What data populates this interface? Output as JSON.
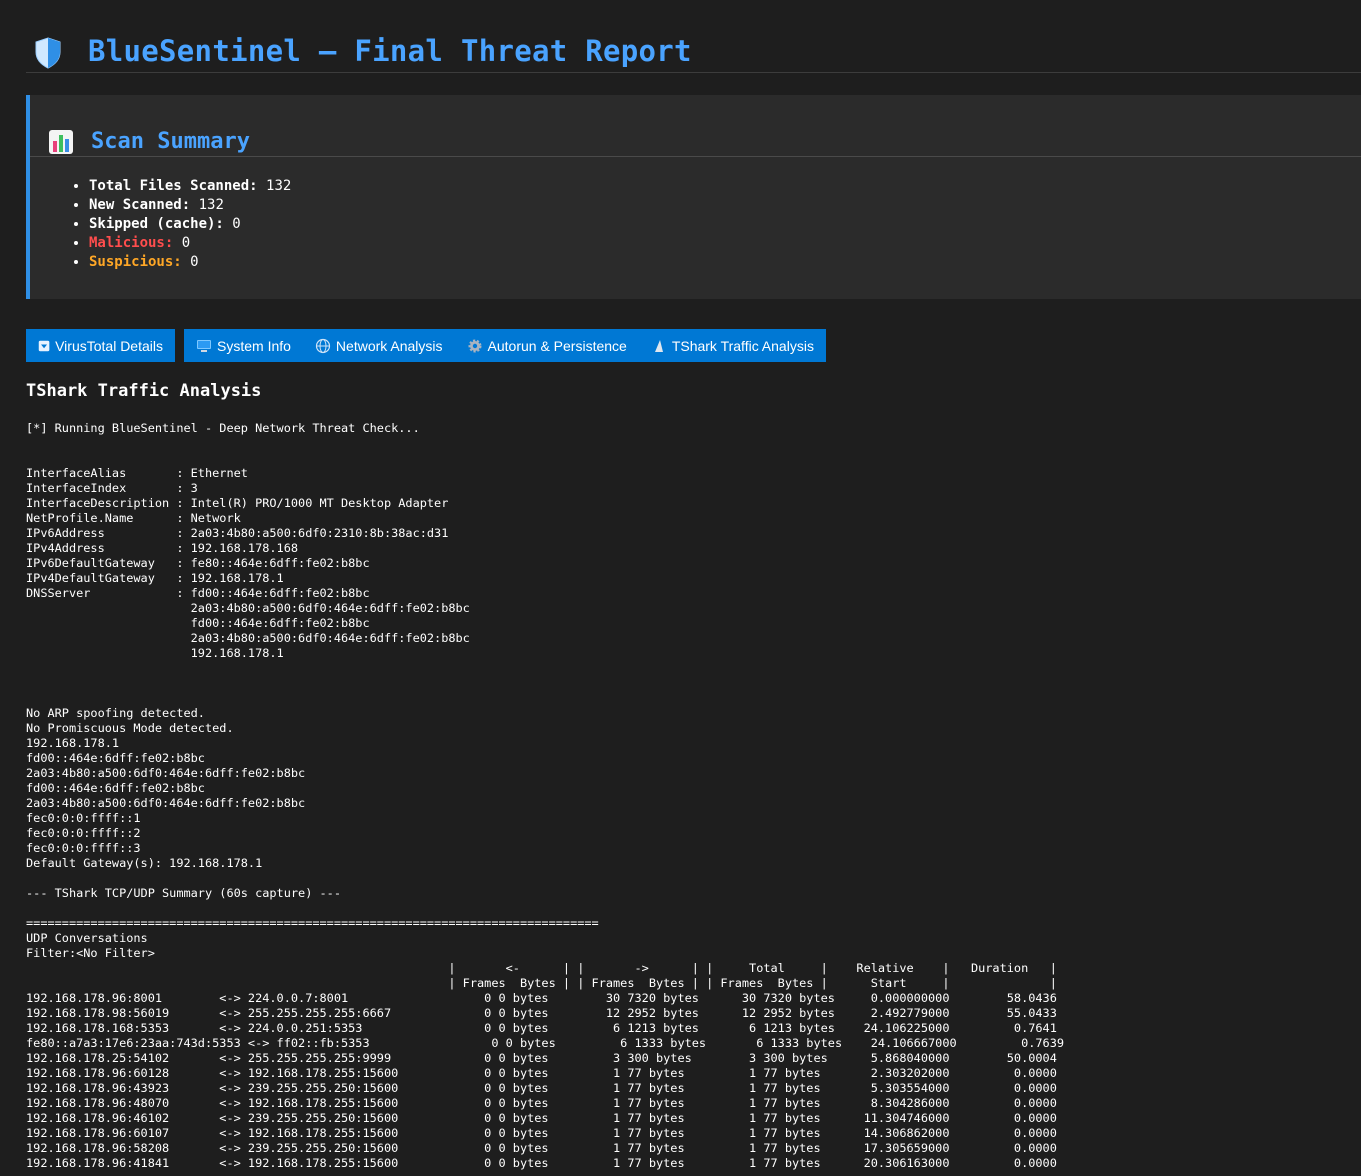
{
  "header": {
    "title": "BlueSentinel – Final Threat Report",
    "icon": "shield-icon"
  },
  "summary": {
    "title": "Scan Summary",
    "icon": "bar-chart-icon",
    "items": [
      {
        "label": "Total Files Scanned:",
        "value": "132"
      },
      {
        "label": "New Scanned:",
        "value": "132"
      },
      {
        "label": "Skipped (cache):",
        "value": "0"
      },
      {
        "label": "Malicious:",
        "value": "0"
      },
      {
        "label": "Suspicious:",
        "value": "0"
      }
    ],
    "colors": {
      "accent": "#4aa3ff",
      "malicious": "#ff4d4d",
      "suspicious": "#ffa726",
      "panel_border": "#2f8fe6"
    }
  },
  "tabs": [
    {
      "label": "VirusTotal Details",
      "icon": "down-arrow-box-icon"
    },
    {
      "label": "System Info",
      "icon": "computer-icon"
    },
    {
      "label": "Network Analysis",
      "icon": "globe-icon"
    },
    {
      "label": "Autorun & Persistence",
      "icon": "gear-icon"
    },
    {
      "label": "TShark Traffic Analysis",
      "icon": "shark-fin-icon"
    }
  ],
  "section": {
    "title": "TShark Traffic Analysis"
  },
  "output": {
    "text": "[*] Running BlueSentinel - Deep Network Threat Check...\n\n\nInterfaceAlias       : Ethernet\nInterfaceIndex       : 3\nInterfaceDescription : Intel(R) PRO/1000 MT Desktop Adapter\nNetProfile.Name      : Network\nIPv6Address          : 2a03:4b80:a500:6df0:2310:8b:38ac:d31\nIPv4Address          : 192.168.178.168\nIPv6DefaultGateway   : fe80::464e:6dff:fe02:b8bc\nIPv4DefaultGateway   : 192.168.178.1\nDNSServer            : fd00::464e:6dff:fe02:b8bc\n                       2a03:4b80:a500:6df0:464e:6dff:fe02:b8bc\n                       fd00::464e:6dff:fe02:b8bc\n                       2a03:4b80:a500:6df0:464e:6dff:fe02:b8bc\n                       192.168.178.1\n\n\n\nNo ARP spoofing detected.\nNo Promiscuous Mode detected.\n192.168.178.1\nfd00::464e:6dff:fe02:b8bc\n2a03:4b80:a500:6df0:464e:6dff:fe02:b8bc\nfd00::464e:6dff:fe02:b8bc\n2a03:4b80:a500:6df0:464e:6dff:fe02:b8bc\nfec0:0:0:ffff::1\nfec0:0:0:ffff::2\nfec0:0:0:ffff::3\nDefault Gateway(s): 192.168.178.1\n\n--- TShark TCP/UDP Summary (60s capture) ---\n\n================================================================================\nUDP Conversations\nFilter:<No Filter>\n                                                           |       <-      | |       ->      | |     Total     |    Relative    |   Duration   |\n                                                           | Frames  Bytes | | Frames  Bytes | | Frames  Bytes |      Start     |              |\n192.168.178.96:8001        <-> 224.0.0.7:8001                   0 0 bytes        30 7320 bytes      30 7320 bytes     0.000000000        58.0436\n192.168.178.98:56019       <-> 255.255.255.255:6667             0 0 bytes        12 2952 bytes      12 2952 bytes     2.492779000        55.0433\n192.168.178.168:5353       <-> 224.0.0.251:5353                 0 0 bytes         6 1213 bytes       6 1213 bytes    24.106225000         0.7641\nfe80::a7a3:17e6:23aa:743d:5353 <-> ff02::fb:5353                 0 0 bytes         6 1333 bytes       6 1333 bytes    24.106667000         0.7639\n192.168.178.25:54102       <-> 255.255.255.255:9999             0 0 bytes         3 300 bytes        3 300 bytes      5.868040000        50.0004\n192.168.178.96:60128       <-> 192.168.178.255:15600            0 0 bytes         1 77 bytes         1 77 bytes       2.303202000         0.0000\n192.168.178.96:43923       <-> 239.255.255.250:15600            0 0 bytes         1 77 bytes         1 77 bytes       5.303554000         0.0000\n192.168.178.96:48070       <-> 192.168.178.255:15600            0 0 bytes         1 77 bytes         1 77 bytes       8.304286000         0.0000\n192.168.178.96:46102       <-> 239.255.255.250:15600            0 0 bytes         1 77 bytes         1 77 bytes      11.304746000         0.0000\n192.168.178.96:60107       <-> 192.168.178.255:15600            0 0 bytes         1 77 bytes         1 77 bytes      14.306862000         0.0000\n192.168.178.96:58208       <-> 239.255.255.250:15600            0 0 bytes         1 77 bytes         1 77 bytes      17.305659000         0.0000\n192.168.178.96:41841       <-> 192.168.178.255:15600            0 0 bytes         1 77 bytes         1 77 bytes      20.306163000         0.0000"
  }
}
